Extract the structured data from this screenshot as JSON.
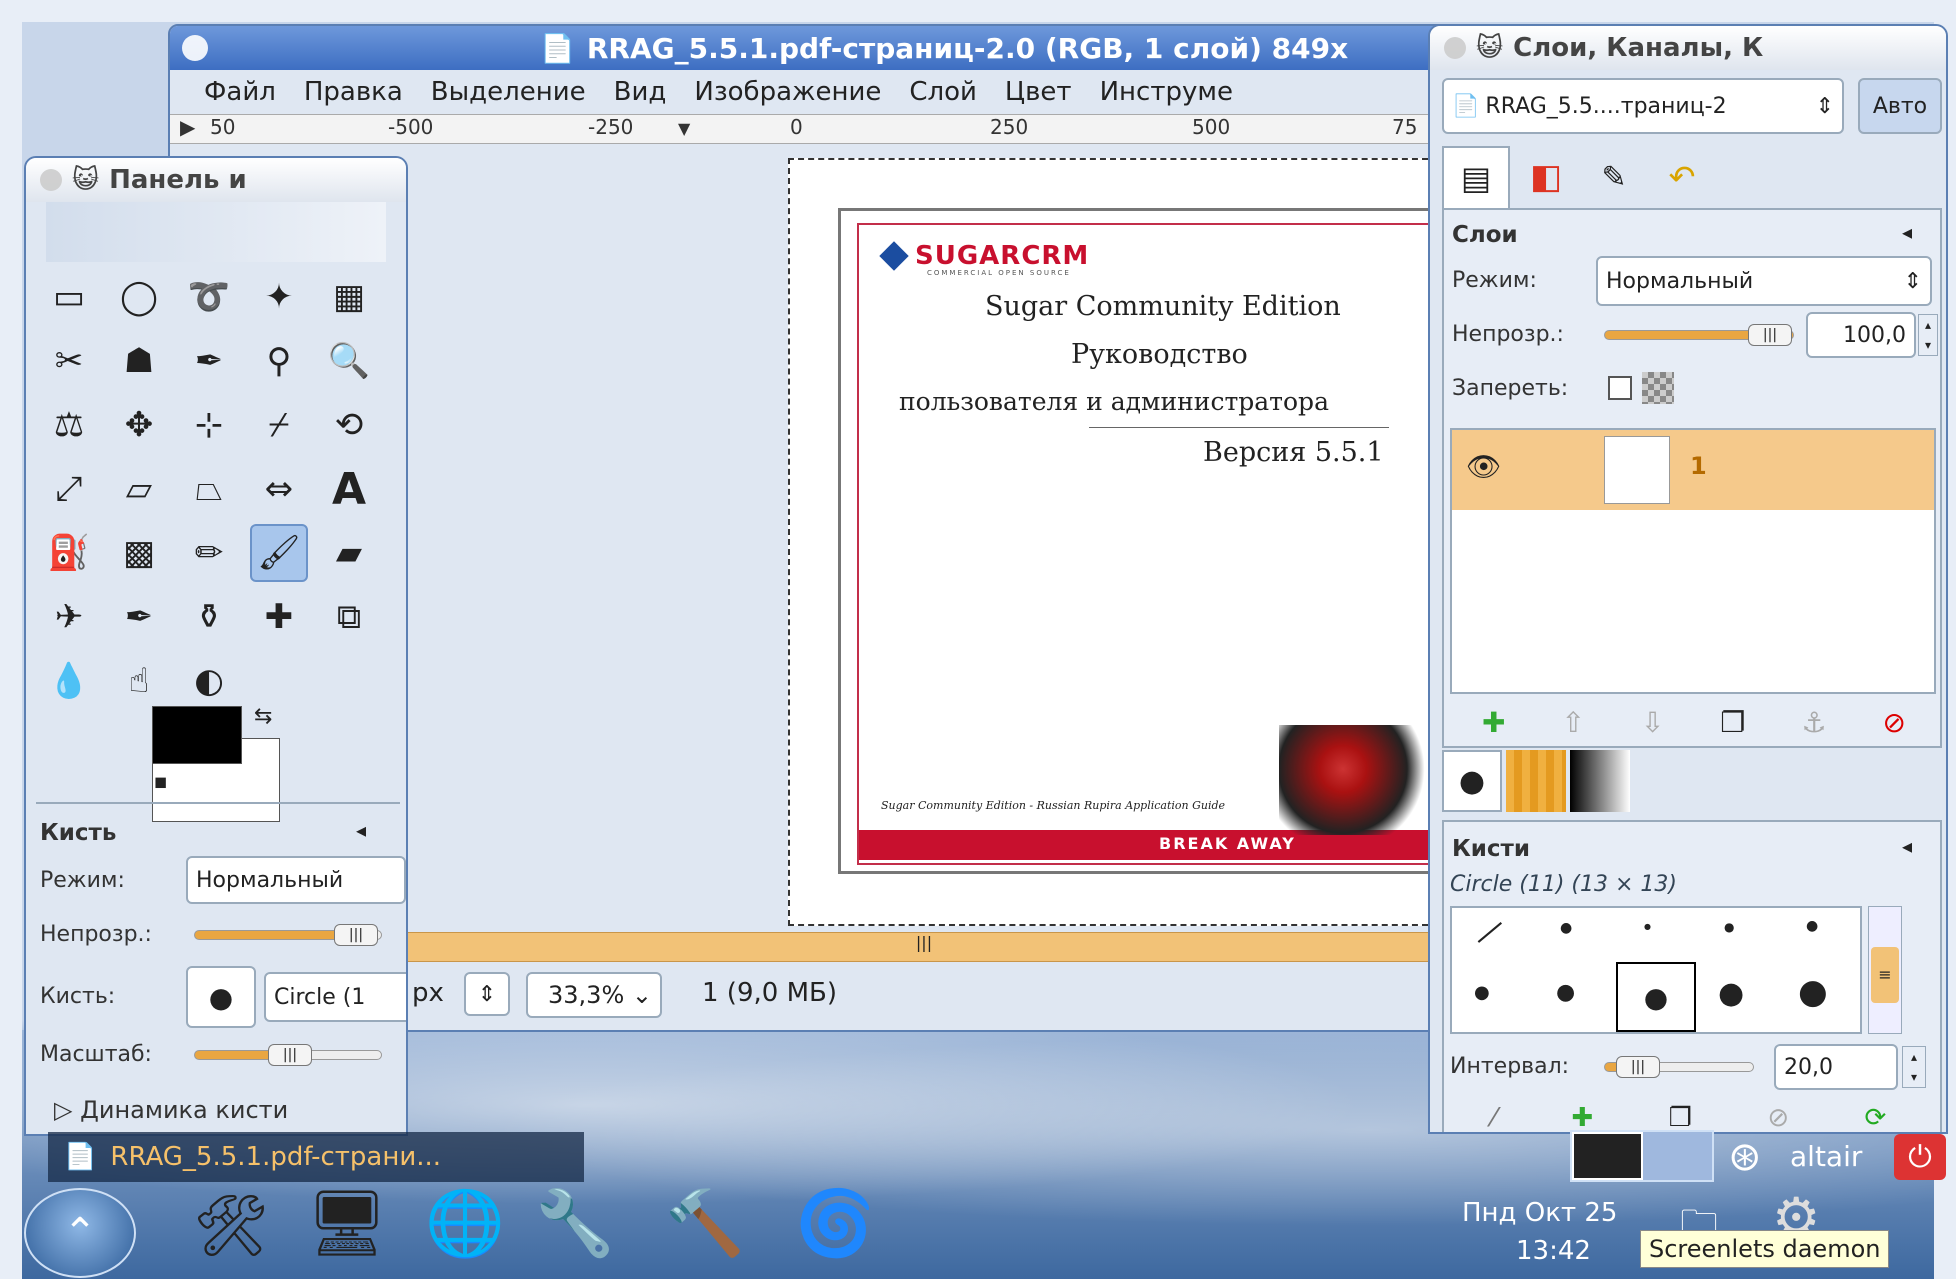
{
  "main_window": {
    "title": "RRAG_5.5.1.pdf-страниц-2.0 (RGB, 1 слой) 849x",
    "menu": [
      "Файл",
      "Правка",
      "Выделение",
      "Вид",
      "Изображение",
      "Слой",
      "Цвет",
      "Инструме"
    ],
    "ruler_labels": [
      "50",
      "-500",
      "-250",
      "0",
      "250",
      "500",
      "75"
    ],
    "status": {
      "unit": "px",
      "zoom": "33,3%",
      "info": "1 (9,0 МБ)"
    }
  },
  "document": {
    "logo_text": "SUGARCRM",
    "logo_sub": "COMMERCIAL OPEN SOURCE",
    "line1": "Sugar Community Edition",
    "line2": "Руководство",
    "line3": "пользователя и администратора",
    "version": "Версия 5.5.1",
    "footer": "Sugar Community Edition - Russian Rupira Application Guide",
    "banner": "BREAK AWAY"
  },
  "toolbox": {
    "title": "Панель и",
    "options_title": "Кисть",
    "mode_label": "Режим:",
    "mode_value": "Нормальный",
    "opacity_label": "Непрозр.:",
    "opacity_fraction": 0.95,
    "brush_label": "Кисть:",
    "brush_value": "Circle (1",
    "scale_label": "Масштаб:",
    "scale_fraction": 0.5,
    "dynamics_label": "Динамика кисти",
    "tools": [
      "rect-select",
      "ellipse-select",
      "free-select",
      "fuzzy-select",
      "color-select",
      "scissors-select",
      "foreground-select",
      "paths",
      "color-picker",
      "zoom",
      "measure",
      "move",
      "align",
      "crop",
      "rotate",
      "scale",
      "shear",
      "perspective",
      "flip",
      "text",
      "bucket-fill",
      "blend",
      "pencil",
      "paintbrush",
      "eraser",
      "airbrush",
      "ink",
      "clone",
      "heal",
      "perspective-clone",
      "blur",
      "smudge",
      "dodge-burn"
    ],
    "fg_color": "#000000",
    "bg_color": "#ffffff"
  },
  "layers_dock": {
    "title": "Слои, Каналы, К",
    "image_selector": "RRAG_5.5....траниц-2",
    "auto_button": "Авто",
    "layers_header": "Слои",
    "mode_label": "Режим:",
    "mode_value": "Нормальный",
    "opacity_label": "Непрозр.:",
    "opacity_value": "100,0",
    "opacity_fraction": 1.0,
    "lock_label": "Запереть:",
    "layer_name": "1",
    "brushes_header": "Кисти",
    "brush_name": "Circle (11) (13 × 13)",
    "interval_label": "Интервал:",
    "interval_value": "20,0",
    "interval_fraction": 0.2
  },
  "taskbar": {
    "window_button": "RRAG_5.5.1.pdf-страни...",
    "user": "altair",
    "clock_date": "Пнд Окт 25",
    "clock_time": "13:42",
    "tooltip": "Screenlets daemon"
  }
}
